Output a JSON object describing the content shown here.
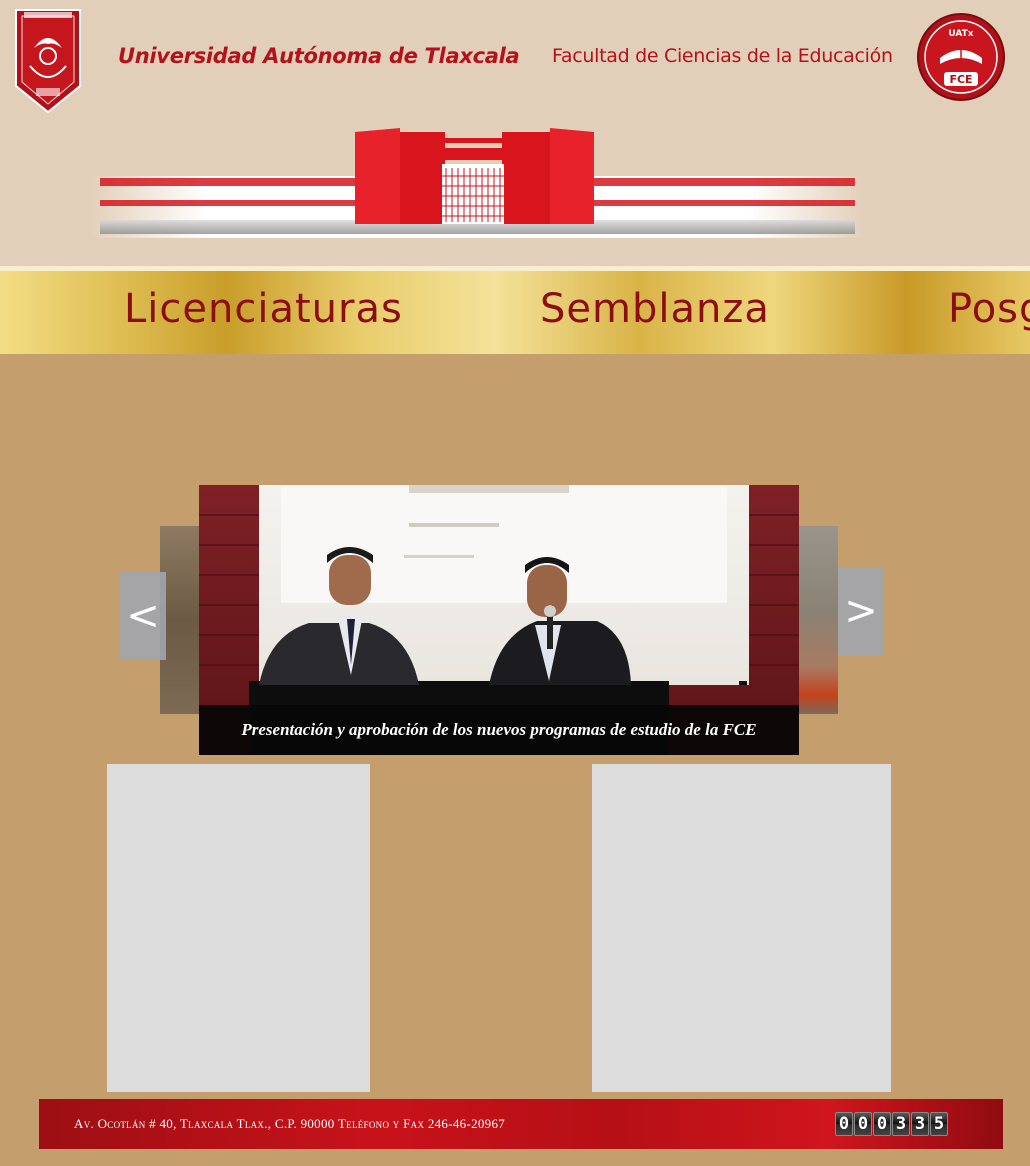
{
  "header": {
    "university_name": "Universidad Autónoma de Tlaxcala",
    "faculty_name": "Facultad de Ciencias de la Educación",
    "fce_logo_top_text": "UATx",
    "fce_logo_bottom_text": "FCE"
  },
  "nav": {
    "items": [
      {
        "label": "Licenciaturas"
      },
      {
        "label": "Semblanza"
      },
      {
        "label": "Posg"
      }
    ]
  },
  "slider": {
    "prev_label": "<",
    "next_label": ">",
    "caption": "Presentación y aprobación de los nuevos programas de estudio de la FCE"
  },
  "footer": {
    "address": "Av. Ocotlán # 40, Tlaxcala Tlax., C.P. 90000 Teléfono y Fax 246-46-20967",
    "counter_digits": [
      "0",
      "0",
      "0",
      "3",
      "3",
      "5"
    ]
  },
  "colors": {
    "brand_red": "#b4121b",
    "header_bg": "#e2cfb9",
    "page_bg": "#c59e6e",
    "nav_text": "#8b0e14"
  }
}
